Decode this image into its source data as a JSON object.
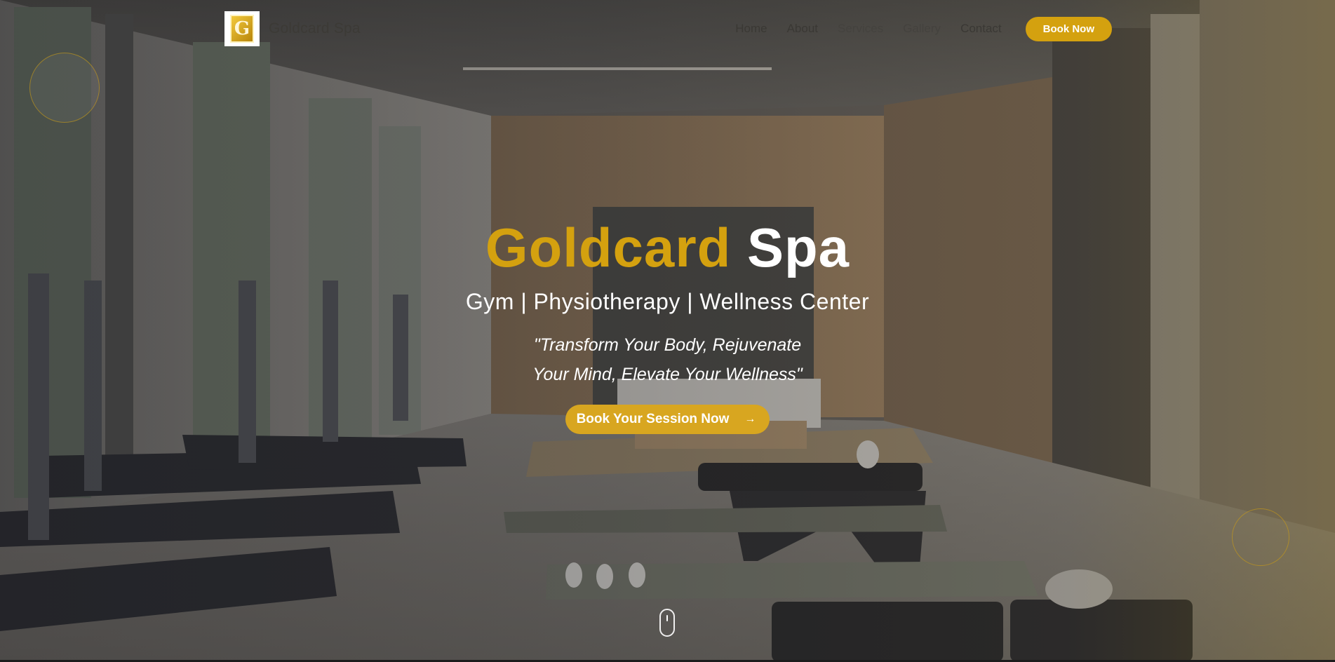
{
  "header": {
    "logo_letter": "G",
    "brand_name": "Goldcard Spa",
    "nav_items": [
      {
        "label": "Home"
      },
      {
        "label": "About"
      },
      {
        "label": "Services"
      },
      {
        "label": "Gallery"
      },
      {
        "label": "Contact"
      }
    ],
    "book_button": "Book Now"
  },
  "hero": {
    "title_gold": "Goldcard",
    "title_white": "Spa",
    "subtitle": "Gym | Physiotherapy | Wellness Center",
    "quote_line1": "\"Transform Your Body, Rejuvenate",
    "quote_line2": "Your Mind, Elevate Your Wellness\"",
    "cta_label": "Book Your Session Now",
    "cta_arrow": "→"
  },
  "colors": {
    "accent_gold": "#d4a10f",
    "text_white": "#ffffff",
    "nav_text": "#3a3834"
  },
  "icons": {
    "logo": "gold-g-logo",
    "cta": "arrow-right-icon",
    "scroll": "mouse-scroll-icon"
  }
}
